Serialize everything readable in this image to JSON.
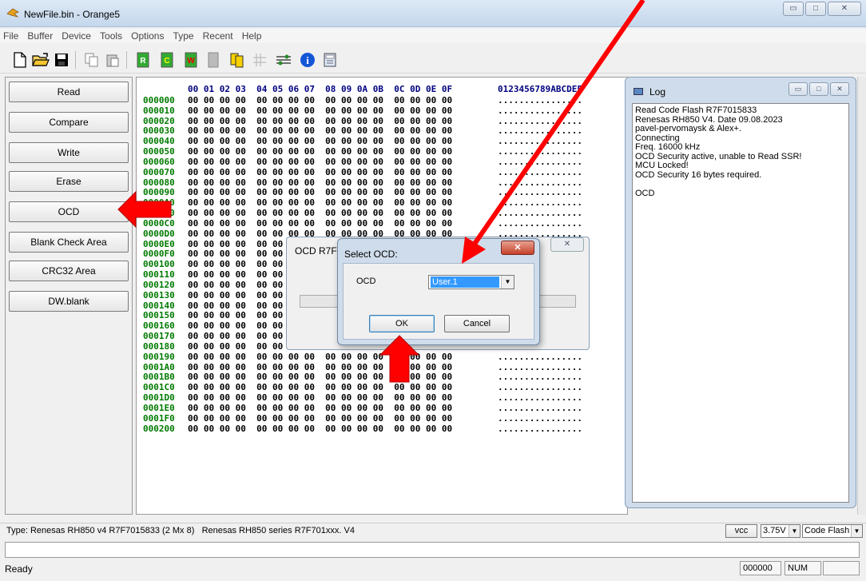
{
  "window": {
    "title": "NewFile.bin - Orange5",
    "min": "▭",
    "max": "□",
    "close": "✕"
  },
  "menu": [
    "File",
    "Buffer",
    "Device",
    "Tools",
    "Options",
    "Type",
    "Recent",
    "Help"
  ],
  "left_buttons": [
    "Read",
    "Compare",
    "Write",
    "Erase",
    "OCD",
    "Blank Check Area",
    "CRC32 Area",
    "DW.blank"
  ],
  "hex": {
    "header_hex": "00 01 02 03  04 05 06 07  08 09 0A 0B  0C 0D 0E 0F",
    "header_ascii": "0123456789ABCDEF",
    "bytes_row": "00 00 00 00  00 00 00 00  00 00 00 00  00 00 00 00",
    "ascii_row": "................",
    "addresses": [
      "000000",
      "000010",
      "000020",
      "000030",
      "000040",
      "000050",
      "000060",
      "000070",
      "000080",
      "000090",
      "0000A0",
      "0000B0",
      "0000C0",
      "0000D0",
      "0000E0",
      "0000F0",
      "000100",
      "000110",
      "000120",
      "000130",
      "000140",
      "000150",
      "000160",
      "000170",
      "000180",
      "000190",
      "0001A0",
      "0001B0",
      "0001C0",
      "0001D0",
      "0001E0",
      "0001F0",
      "000200"
    ]
  },
  "log": {
    "title": "Log",
    "lines": [
      "Read Code Flash R7F7015833",
      "Renesas RH850 V4. Date 09.08.2023",
      "pavel-pervomaysk & Alex+.",
      "Connecting",
      "Freq. 16000 kHz",
      "OCD Security active, unable to Read SSR!",
      "MCU Locked!",
      "OCD Security 16 bytes required.",
      "",
      "OCD"
    ]
  },
  "ocd_window": {
    "title": "OCD R7F7015833"
  },
  "select_dialog": {
    "title": "Select OCD:",
    "close": "✕",
    "label": "OCD",
    "selected": "User.1",
    "ok": "OK",
    "cancel": "Cancel"
  },
  "status": {
    "type_text": "Type: Renesas RH850 v4 R7F7015833 (2 Mx 8)   Renesas RH850 series R7F701xxx. V4",
    "vcc": "vcc",
    "voltage": "3.75V",
    "area": "Code Flash",
    "ready": "Ready",
    "address": "000000",
    "num": "NUM"
  },
  "colors": {
    "arrow": "#ff0000",
    "address": "#007a00",
    "selection": "#3399ff"
  }
}
